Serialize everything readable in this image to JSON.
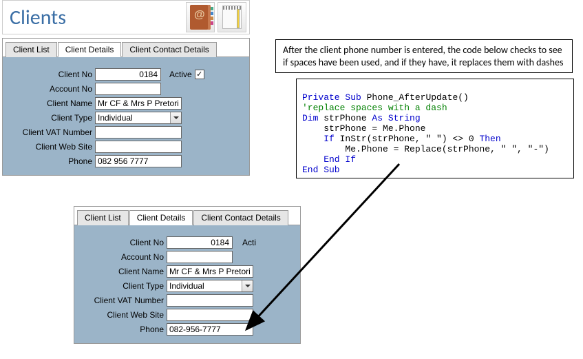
{
  "header": {
    "title": "Clients"
  },
  "form1": {
    "tabs": [
      "Client List",
      "Client Details",
      "Client Contact Details"
    ],
    "activeTab": 1,
    "labels": {
      "clientNo": "Client No",
      "accountNo": "Account No",
      "clientName": "Client Name",
      "clientType": "Client Type",
      "clientVat": "Client VAT Number",
      "clientWeb": "Client Web Site",
      "phone": "Phone",
      "active": "Active"
    },
    "values": {
      "clientNo": "0184",
      "accountNo": "",
      "clientName": "Mr CF & Mrs P Pretorius",
      "clientType": "Individual",
      "clientVat": "",
      "clientWeb": "",
      "phone": "082 956 7777",
      "activeChecked": true
    }
  },
  "form2": {
    "tabs": [
      "Client List",
      "Client Details",
      "Client Contact Details"
    ],
    "activeTab": 1,
    "labels": {
      "clientNo": "Client No",
      "accountNo": "Account No",
      "clientName": "Client Name",
      "clientType": "Client Type",
      "clientVat": "Client VAT Number",
      "clientWeb": "Client Web Site",
      "phone": "Phone",
      "active": "Acti"
    },
    "values": {
      "clientNo": "0184",
      "accountNo": "",
      "clientName": "Mr CF & Mrs P Pretorius",
      "clientType": "Individual",
      "clientVat": "",
      "clientWeb": "",
      "phone": "082-956-7777"
    }
  },
  "explanation": "After the client phone number is entered, the code below checks to see if spaces have been used, and if they have, it replaces them with dashes",
  "code": {
    "l1a": "Private Sub",
    "l1b": " Phone_AfterUpdate()",
    "l2": "'replace spaces with a dash",
    "l3a": "Dim",
    "l3b": " strPhone ",
    "l3c": "As String",
    "l4": "    strPhone = Me.Phone",
    "l5a": "    If",
    "l5b": " InStr(strPhone, \" \") <> 0 ",
    "l5c": "Then",
    "l6": "        Me.Phone = Replace(strPhone, \" \", \"-\")",
    "l7": "    End If",
    "l8": "End Sub"
  },
  "checkmark": "✓"
}
